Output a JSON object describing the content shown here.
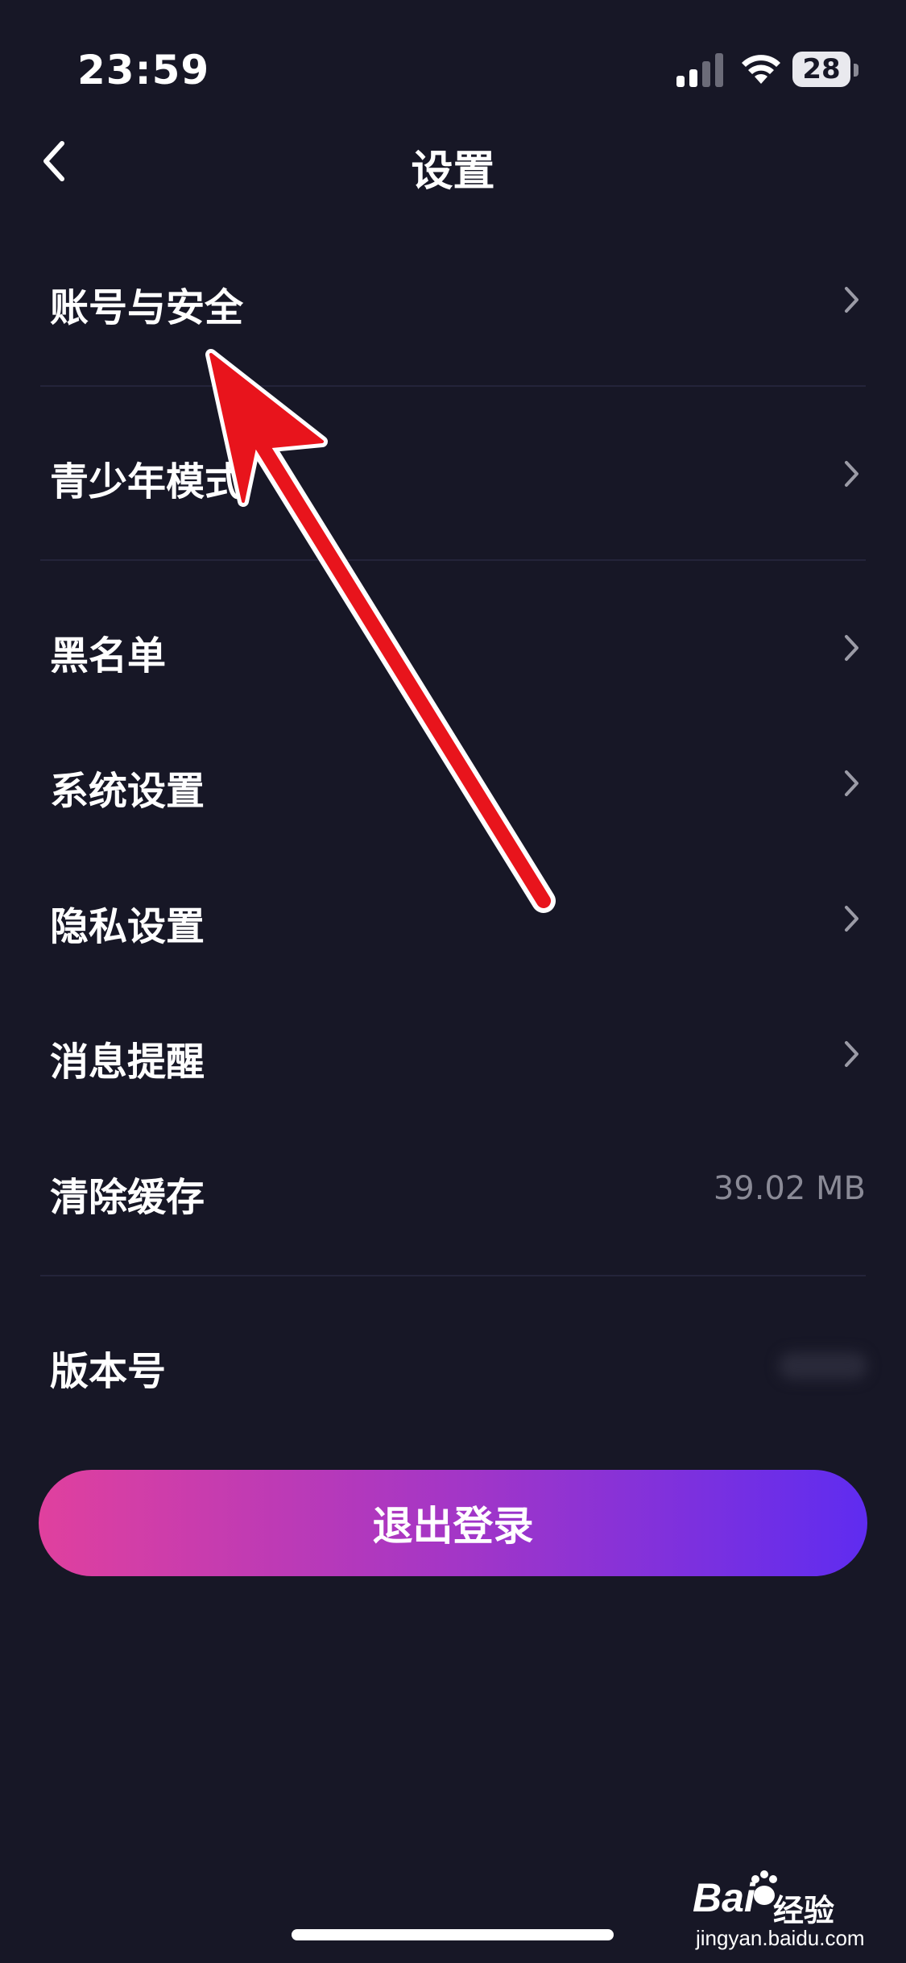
{
  "status_bar": {
    "time": "23:59",
    "battery": "28",
    "icons": [
      "signal-icon",
      "wifi-icon",
      "battery-icon"
    ]
  },
  "nav": {
    "title": "设置",
    "back_icon": "chevron-left-icon"
  },
  "menu": [
    {
      "label": "账号与安全",
      "icon": "chevron-right-icon"
    },
    {
      "label": "青少年模式",
      "icon": "chevron-right-icon"
    },
    {
      "label": "黑名单",
      "icon": "chevron-right-icon"
    },
    {
      "label": "系统设置",
      "icon": "chevron-right-icon"
    },
    {
      "label": "隐私设置",
      "icon": "chevron-right-icon"
    },
    {
      "label": "消息提醒",
      "icon": "chevron-right-icon"
    },
    {
      "label": "清除缓存",
      "value": "39.02 MB"
    },
    {
      "label": "版本号"
    }
  ],
  "logout": {
    "label": "退出登录",
    "gradient": [
      "#e0409e",
      "#a436c6",
      "#5f2cf0"
    ]
  },
  "annotation": {
    "arrow_color": "#e8141c"
  },
  "watermark": {
    "brand": "Bai",
    "brand_suffix": "经验",
    "url": "jingyan.baidu.com"
  },
  "colors": {
    "background": "#171726",
    "divider": "#24243a",
    "secondary_text": "#8a8a96"
  }
}
